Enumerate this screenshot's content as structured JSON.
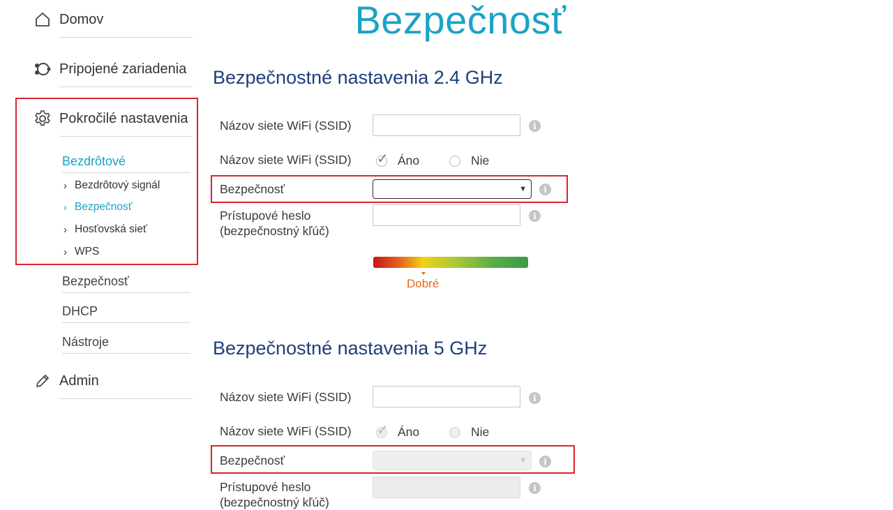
{
  "sidebar": {
    "home": {
      "label": "Domov",
      "icon": "home-icon"
    },
    "devices": {
      "label": "Pripojené zariadenia",
      "icon": "devices-icon"
    },
    "advanced": {
      "label": "Pokročilé nastavenia",
      "icon": "gear-icon",
      "wireless": {
        "label": "Bezdrôtové",
        "items": [
          {
            "label": "Bezdrôtový signál",
            "active": false
          },
          {
            "label": "Bezpečnosť",
            "active": true
          },
          {
            "label": "Hosťovská sieť",
            "active": false
          },
          {
            "label": "WPS",
            "active": false
          }
        ]
      },
      "security": {
        "label": "Bezpečnosť"
      },
      "dhcp": {
        "label": "DHCP"
      },
      "tools": {
        "label": "Nástroje"
      }
    },
    "admin": {
      "label": "Admin",
      "icon": "pencil-icon"
    }
  },
  "page": {
    "title": "Bezpečnosť"
  },
  "section24": {
    "title": "Bezpečnostné nastavenia 2.4 GHz",
    "ssid_label": "Názov siete WiFi (SSID)",
    "ssid_value": "",
    "broadcast_label": "Názov siete WiFi (SSID)",
    "yes_label": "Áno",
    "no_label": "Nie",
    "broadcast_selected": "yes",
    "security_label": "Bezpečnosť",
    "security_value": "",
    "password_label_line1": "Prístupové heslo",
    "password_label_line2": "(bezpečnostný kľúč)",
    "password_value": "",
    "strength_label": "Dobré",
    "strength_level": 0.32
  },
  "section5": {
    "title": "Bezpečnostné nastavenia 5 GHz",
    "ssid_label": "Názov siete WiFi (SSID)",
    "ssid_value": "",
    "broadcast_label": "Názov siete WiFi (SSID)",
    "yes_label": "Áno",
    "no_label": "Nie",
    "broadcast_selected": "yes",
    "security_label": "Bezpečnosť",
    "security_value": "",
    "password_label_line1": "Prístupové heslo",
    "password_label_line2": "(bezpečnostný kľúč)",
    "password_value": ""
  },
  "colors": {
    "accent": "#1aa3c4",
    "heading": "#1e3f7a",
    "highlight": "#d7262c",
    "strength": "#e46a1c",
    "check": "#3aa84a"
  }
}
